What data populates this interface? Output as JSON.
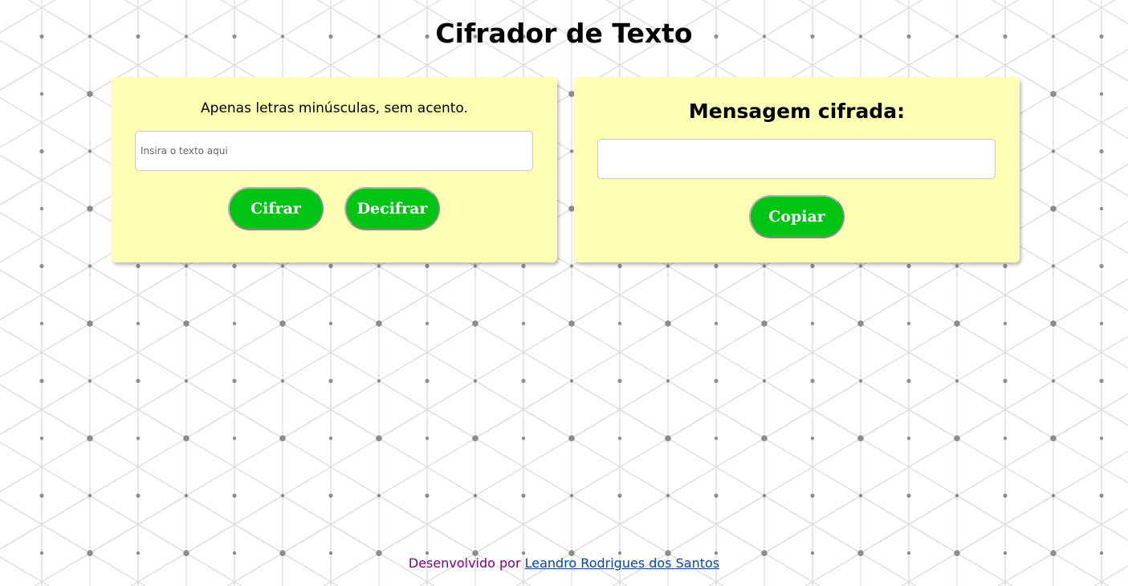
{
  "page": {
    "title": "Cifrador de Texto"
  },
  "encoder": {
    "instruction": "Apenas letras minúsculas, sem acento.",
    "input_value": "",
    "input_placeholder": "Insira o texto aqui",
    "encrypt_label": "Cifrar",
    "decrypt_label": "Decifrar"
  },
  "result": {
    "title": "Mensagem cifrada:",
    "value": "",
    "copy_label": "Copiar"
  },
  "footer": {
    "prefix": "Desenvolvido por",
    "author_link": "Leandro Rodrigues dos Santos"
  },
  "colors": {
    "card_background": "#ffffb4",
    "button_green": "#00c414",
    "footer_text": "#800080",
    "link": "#0645ad"
  }
}
